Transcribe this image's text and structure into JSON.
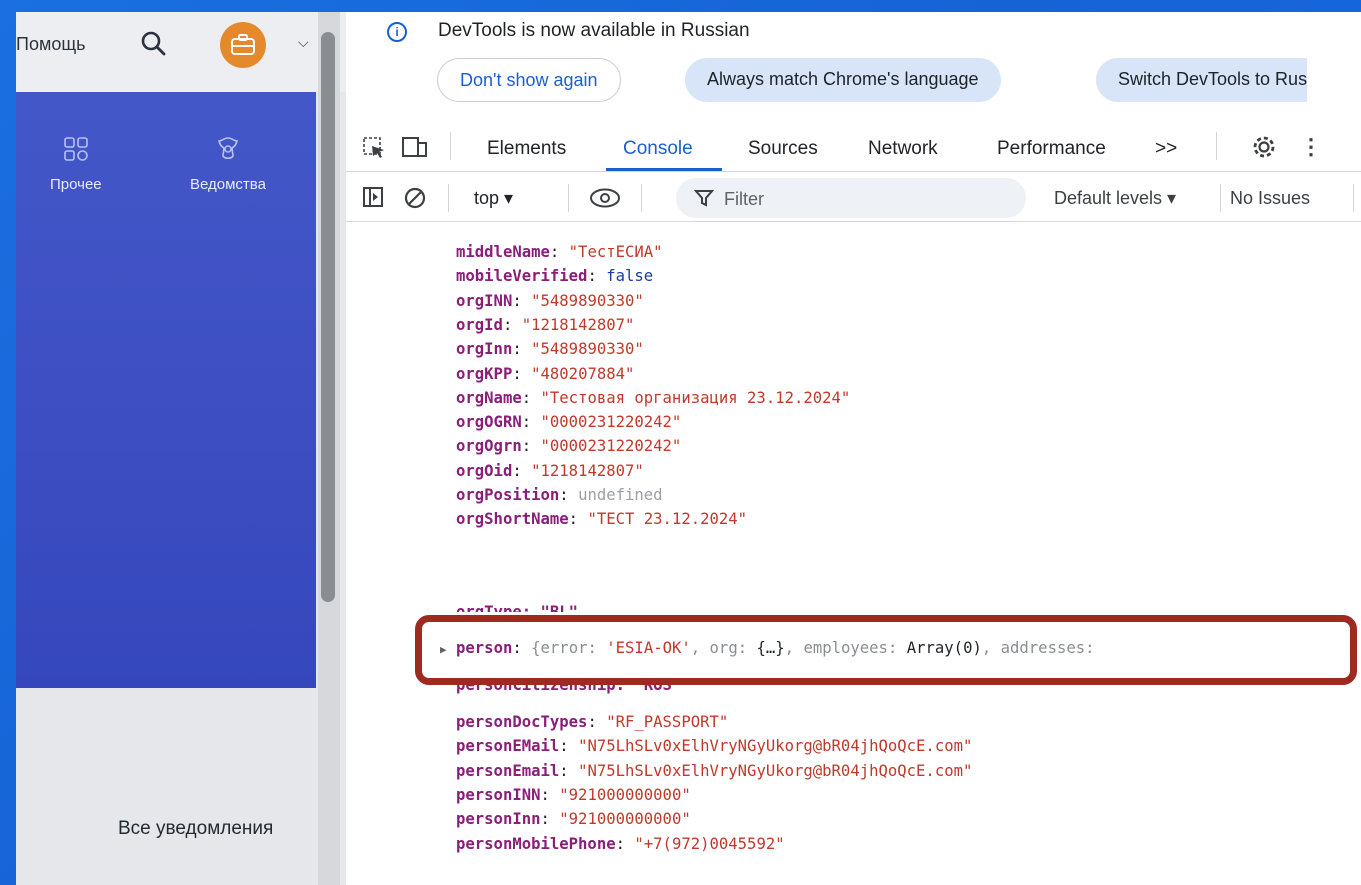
{
  "site": {
    "help_label": "Помощь",
    "nav": [
      {
        "label": "Прочее"
      },
      {
        "label": "Ведомства"
      }
    ],
    "all_notifications": "Все уведомления"
  },
  "devtools": {
    "info": {
      "message": "DevTools is now available in Russian",
      "dont_show": "Don't show again",
      "always_match": "Always match Chrome's language",
      "switch": "Switch DevTools to Rus"
    },
    "tabs": [
      "Elements",
      "Console",
      "Sources",
      "Network",
      "Performance"
    ],
    "active_tab": "Console",
    "more_tabs": ">>",
    "toolbar": {
      "context": "top ▾",
      "filter_placeholder": "Filter",
      "levels": "Default levels ▾",
      "issues": "No Issues"
    }
  },
  "console": {
    "lines": [
      {
        "key": "middleName",
        "value": "\"ТестЕСИА\"",
        "type": "string"
      },
      {
        "key": "mobileVerified",
        "value": "false",
        "type": "keyword"
      },
      {
        "key": "orgINN",
        "value": "\"5489890330\"",
        "type": "string"
      },
      {
        "key": "orgId",
        "value": "\"1218142807\"",
        "type": "string"
      },
      {
        "key": "orgInn",
        "value": "\"5489890330\"",
        "type": "string"
      },
      {
        "key": "orgKPP",
        "value": "\"480207884\"",
        "type": "string"
      },
      {
        "key": "orgName",
        "value": "\"Тестовая организация 23.12.2024\"",
        "type": "string"
      },
      {
        "key": "orgOGRN",
        "value": "\"0000231220242\"",
        "type": "string"
      },
      {
        "key": "orgOgrn",
        "value": "\"0000231220242\"",
        "type": "string"
      },
      {
        "key": "orgOid",
        "value": "\"1218142807\"",
        "type": "string"
      },
      {
        "key": "orgPosition",
        "value": "undefined",
        "type": "undefined"
      },
      {
        "key": "orgShortName",
        "value": "\"ТЕСТ 23.12.2024\"",
        "type": "string"
      }
    ],
    "partial_above": "orgType: \"BL\"",
    "highlighted": {
      "key": "person",
      "open": "{",
      "error_key": "error",
      "error_val": "'ESIA-OK'",
      "org_key": "org",
      "org_val": "{…}",
      "emp_key": "employees",
      "emp_val": "Array(0)",
      "addr_key": "addresses"
    },
    "partial_below": "personCitizenship: \"RUS\"",
    "lines2": [
      {
        "key": "personDocTypes",
        "value": "\"RF_PASSPORT\"",
        "type": "string"
      },
      {
        "key": "personEMail",
        "value": "\"N75LhSLv0xElhVryNGyUkorg@bR04jhQoQcE.com\"",
        "type": "string"
      },
      {
        "key": "personEmail",
        "value": "\"N75LhSLv0xElhVryNGyUkorg@bR04jhQoQcE.com\"",
        "type": "string"
      },
      {
        "key": "personINN",
        "value": "\"921000000000\"",
        "type": "string"
      },
      {
        "key": "personInn",
        "value": "\"921000000000\"",
        "type": "string"
      },
      {
        "key": "personMobilePhone",
        "value": "\"+7(972)0045592\"",
        "type": "string"
      }
    ]
  },
  "colors": {
    "accent": "#1a5fd0",
    "highlight_border": "#9e2a22",
    "site_nav": "#3f52c4",
    "avatar": "#e58a2c"
  }
}
